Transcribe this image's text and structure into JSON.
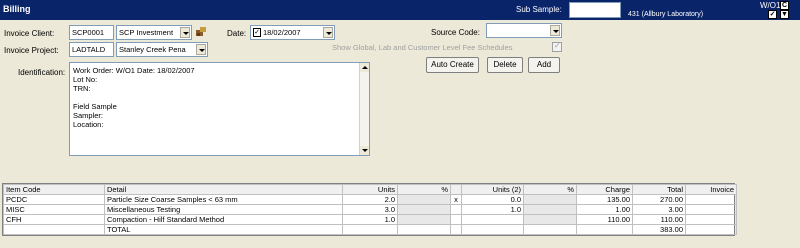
{
  "app": {
    "title": "Billing",
    "sub_sample_label": "Sub Sample:",
    "sub_sample_value": "",
    "work_order": "W/O1",
    "lab": "431 (Allbury Laboratory)",
    "btn_c": "C",
    "btn_v": "▼"
  },
  "form": {
    "invoice_client_label": "Invoice Client:",
    "client_code": "SCP0001",
    "client_name": "SCP Investment",
    "invoice_project_label": "Invoice Project:",
    "project_code": "LADTALD",
    "project_name": "Stanley Creek Pena",
    "date_label": "Date:",
    "date_value": "18/02/2007",
    "source_code_label": "Source Code:",
    "source_code_value": "",
    "global_fee_label": "Show Global, Lab and Customer Level Fee Schedules",
    "identification_label": "Identification:",
    "identification_lines": [
      "Work Order: W/O1  Date: 18/02/2007",
      "Lot No:",
      "TRN:",
      "",
      "Field Sample",
      "Sampler:",
      "Location:"
    ]
  },
  "buttons": {
    "auto_create": "Auto Create",
    "delete": "Delete",
    "add": "Add"
  },
  "grid": {
    "headers": [
      "Item Code",
      "Detail",
      "Units",
      "%",
      "",
      "Units (2)",
      "%",
      "Charge",
      "Total",
      "Invoice"
    ],
    "rows": [
      {
        "code": "PCDC",
        "detail": "Particle Size Coarse Samples < 63 mm",
        "units": "2.0",
        "ind": "x",
        "units2": "0.0",
        "charge": "135.00",
        "total": "270.00"
      },
      {
        "code": "MISC",
        "detail": "Miscellaneous Testing",
        "units": "3.0",
        "ind": "",
        "units2": "1.0",
        "charge": "1.00",
        "total": "3.00"
      },
      {
        "code": "CFH",
        "detail": "Compaction - Hilf Standard Method",
        "units": "1.0",
        "ind": "",
        "units2": "",
        "charge": "110.00",
        "total": "110.00"
      },
      {
        "code": "",
        "detail": "TOTAL",
        "units": "",
        "ind": "",
        "units2": "",
        "charge": "",
        "total": "383.00"
      }
    ]
  },
  "colors": {
    "titlebar": "#0a246a",
    "background": "#ece9d8"
  }
}
